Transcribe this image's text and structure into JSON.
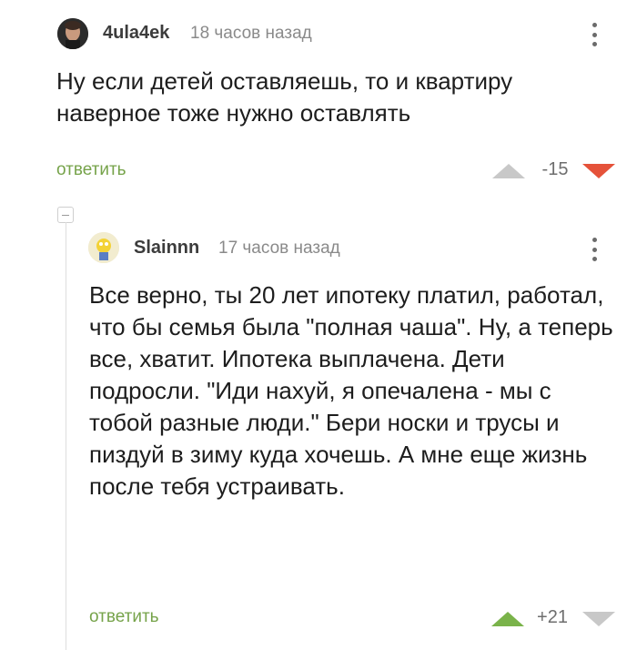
{
  "comments": [
    {
      "username": "4ula4ek",
      "time": "18 часов назад",
      "text": "Ну если детей оставляешь, то и квартиру наверное тоже нужно оставлять",
      "reply_label": "ответить",
      "rating": "-15",
      "user_vote": "down"
    },
    {
      "username": "Slainnn",
      "time": "17 часов назад",
      "text": "Все верно, ты 20 лет ипотеку платил, работал, что бы семья была \"полная чаша\". Ну, а теперь все, хватит. Ипотека выплачена. Дети подросли. \"Иди нахуй, я опечалена - мы с тобой разные люди.\" Бери носки и трусы и пиздуй в зиму куда хочешь. А мне еще жизнь после тебя устраивать.",
      "reply_label": "ответить",
      "rating": "+21",
      "user_vote": "up"
    }
  ],
  "colors": {
    "reply_link": "#76a34a",
    "vote_up_active": "#7ab34a",
    "vote_down_active": "#e5523a",
    "vote_inactive": "#c8c8c8"
  }
}
